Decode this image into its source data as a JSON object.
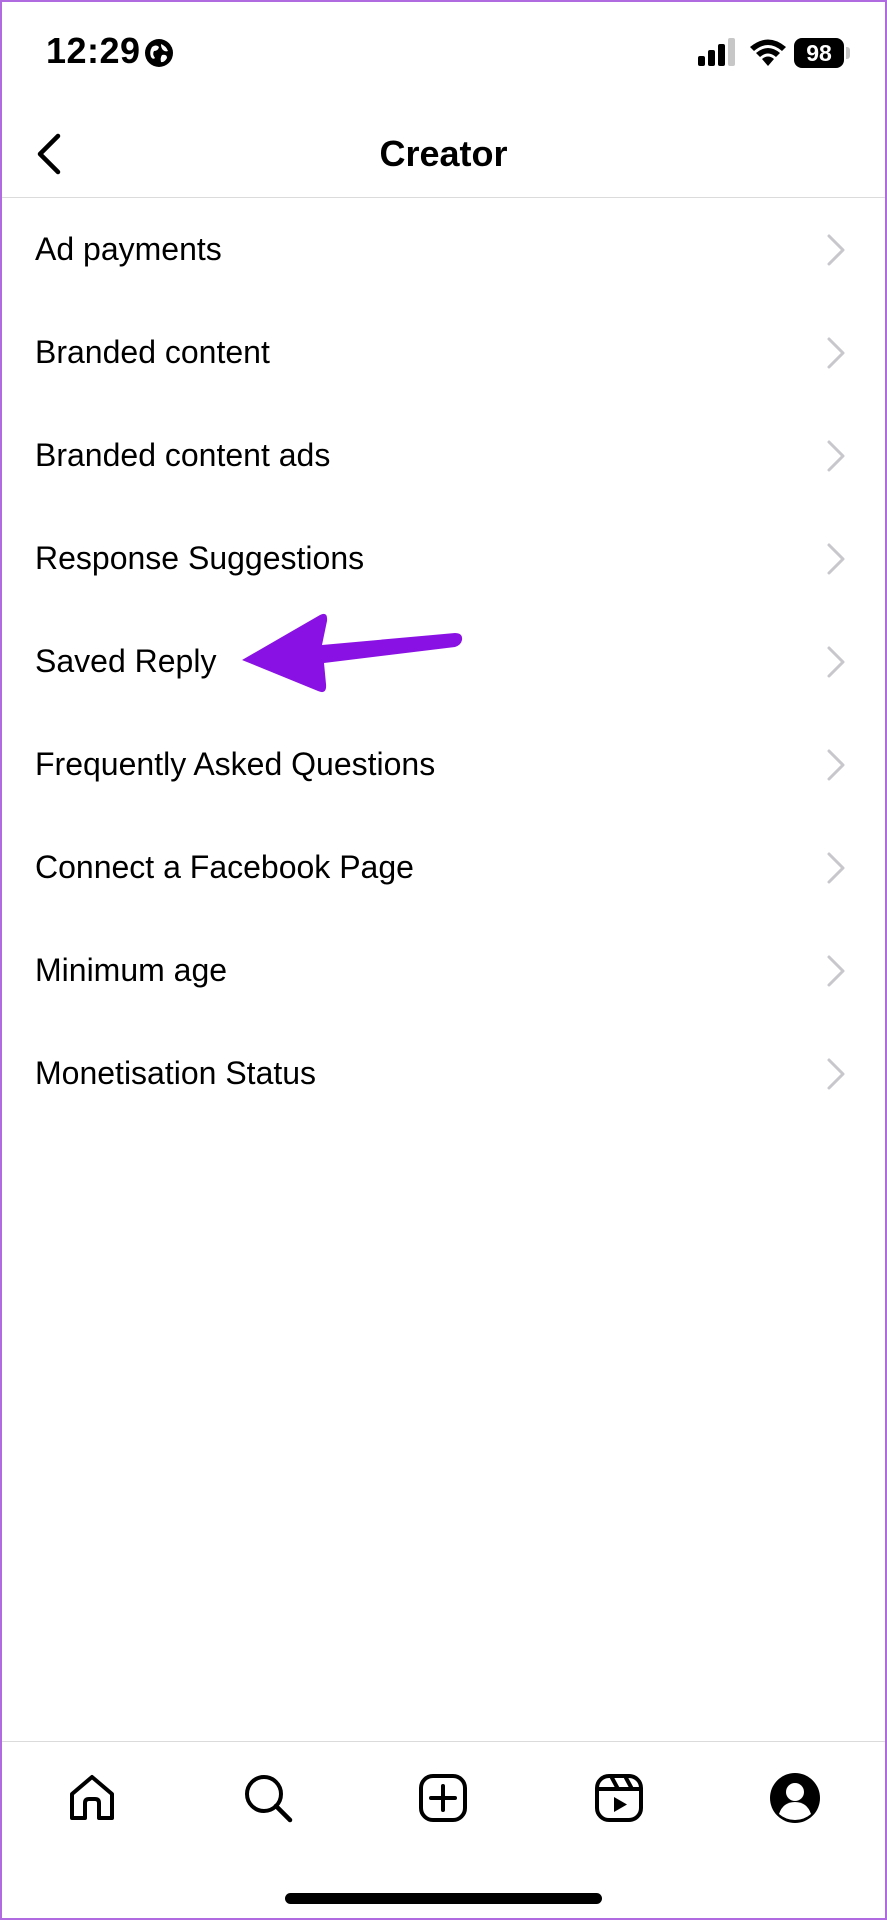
{
  "status_bar": {
    "time": "12:29",
    "battery": "98"
  },
  "header": {
    "title": "Creator"
  },
  "menu": {
    "items": [
      {
        "label": "Ad payments"
      },
      {
        "label": "Branded content"
      },
      {
        "label": "Branded content ads"
      },
      {
        "label": "Response Suggestions"
      },
      {
        "label": "Saved Reply"
      },
      {
        "label": "Frequently Asked Questions"
      },
      {
        "label": "Connect a Facebook Page"
      },
      {
        "label": "Minimum age"
      },
      {
        "label": "Monetisation Status"
      }
    ]
  },
  "annotation": {
    "color": "#8a11e3",
    "points_to": "Saved Reply"
  },
  "tabs": [
    {
      "icon": "home-icon"
    },
    {
      "icon": "search-icon"
    },
    {
      "icon": "create-post-icon"
    },
    {
      "icon": "reels-icon"
    },
    {
      "icon": "profile-icon"
    }
  ],
  "colors": {
    "divider": "#dbdbdb",
    "chevron": "#c7c7cc",
    "frame": "#b06be0"
  }
}
